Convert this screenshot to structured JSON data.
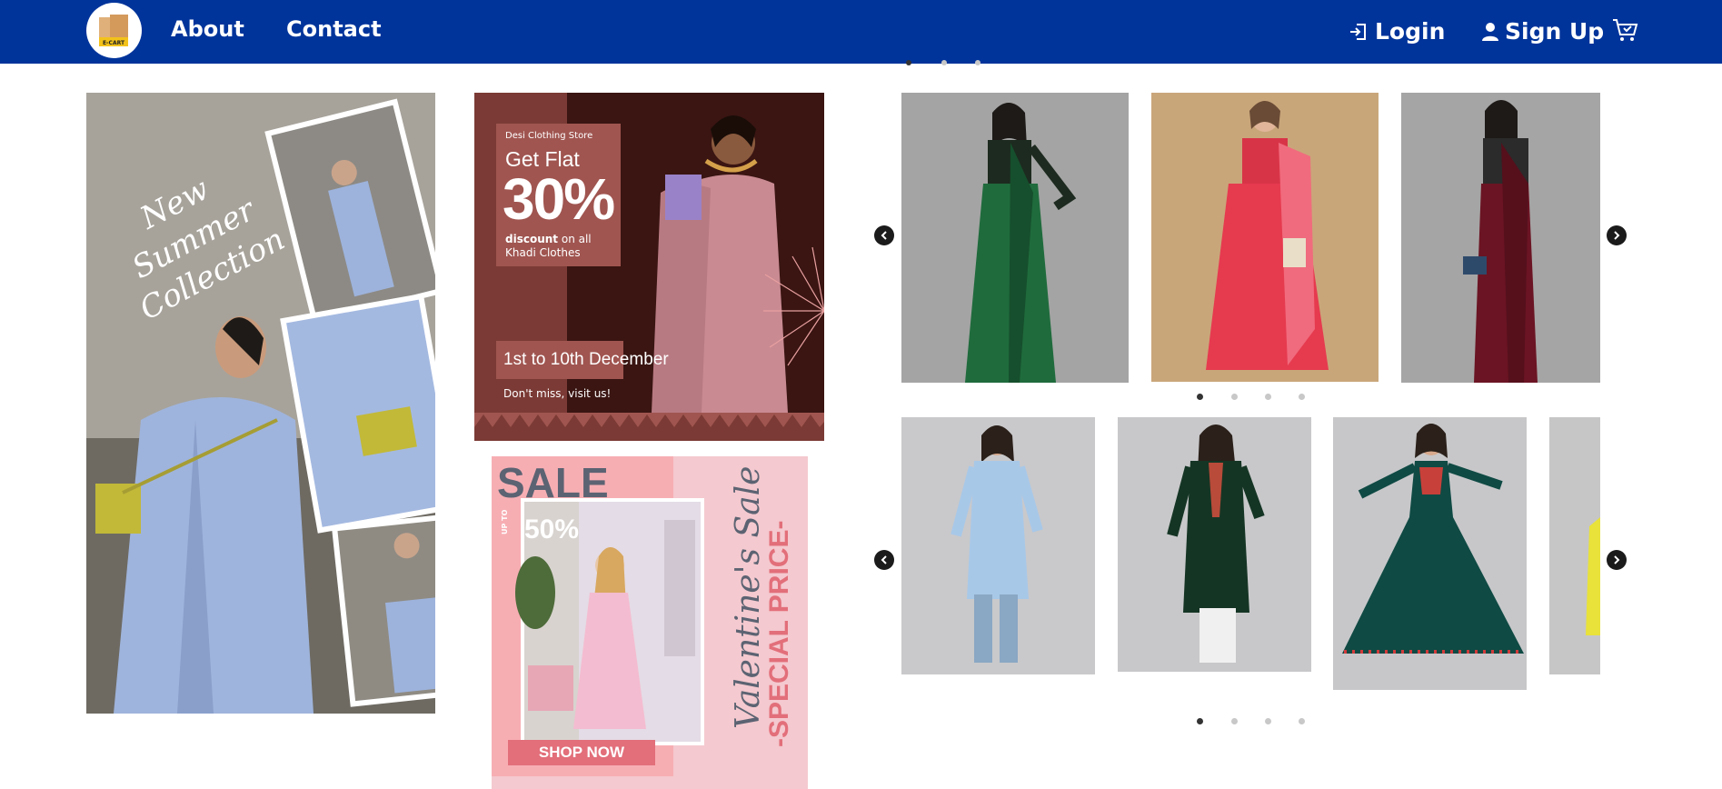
{
  "nav": {
    "logo_text": "E-CART",
    "about": "About",
    "contact": "Contact",
    "login": "Login",
    "signup": "Sign Up"
  },
  "promo_summer": {
    "title_line1": "New Summer",
    "title_line2": "Collection"
  },
  "promo_khadi": {
    "store": "Desi Clothing Store",
    "get_flat": "Get Flat",
    "percent": "30%",
    "discount_bold": "discount",
    "discount_rest": "on all",
    "khadi": "Khadi Clothes",
    "dates": "1st to 10th December",
    "visit": "Don't miss, visit us!"
  },
  "promo_val": {
    "sale": "SALE",
    "upto": "UP TO",
    "percent": "50%",
    "shop": "SHOP NOW",
    "script": "Valentine's Sale",
    "special": "-SPECIAL PRICE-"
  },
  "carousel_sarees": {
    "items": [
      "green-saree",
      "red-saree",
      "maroon-saree"
    ],
    "dots": 4,
    "active_dot": 0
  },
  "carousel_kurtas": {
    "items": [
      "blue-kurta",
      "green-kurta",
      "teal-anarkali",
      "yellow-partial"
    ],
    "dots": 4,
    "active_dot": 0
  },
  "colors": {
    "navbar": "#00349b",
    "khadi_bg": "#7b3a35",
    "val_pink": "#f4c9cf"
  }
}
